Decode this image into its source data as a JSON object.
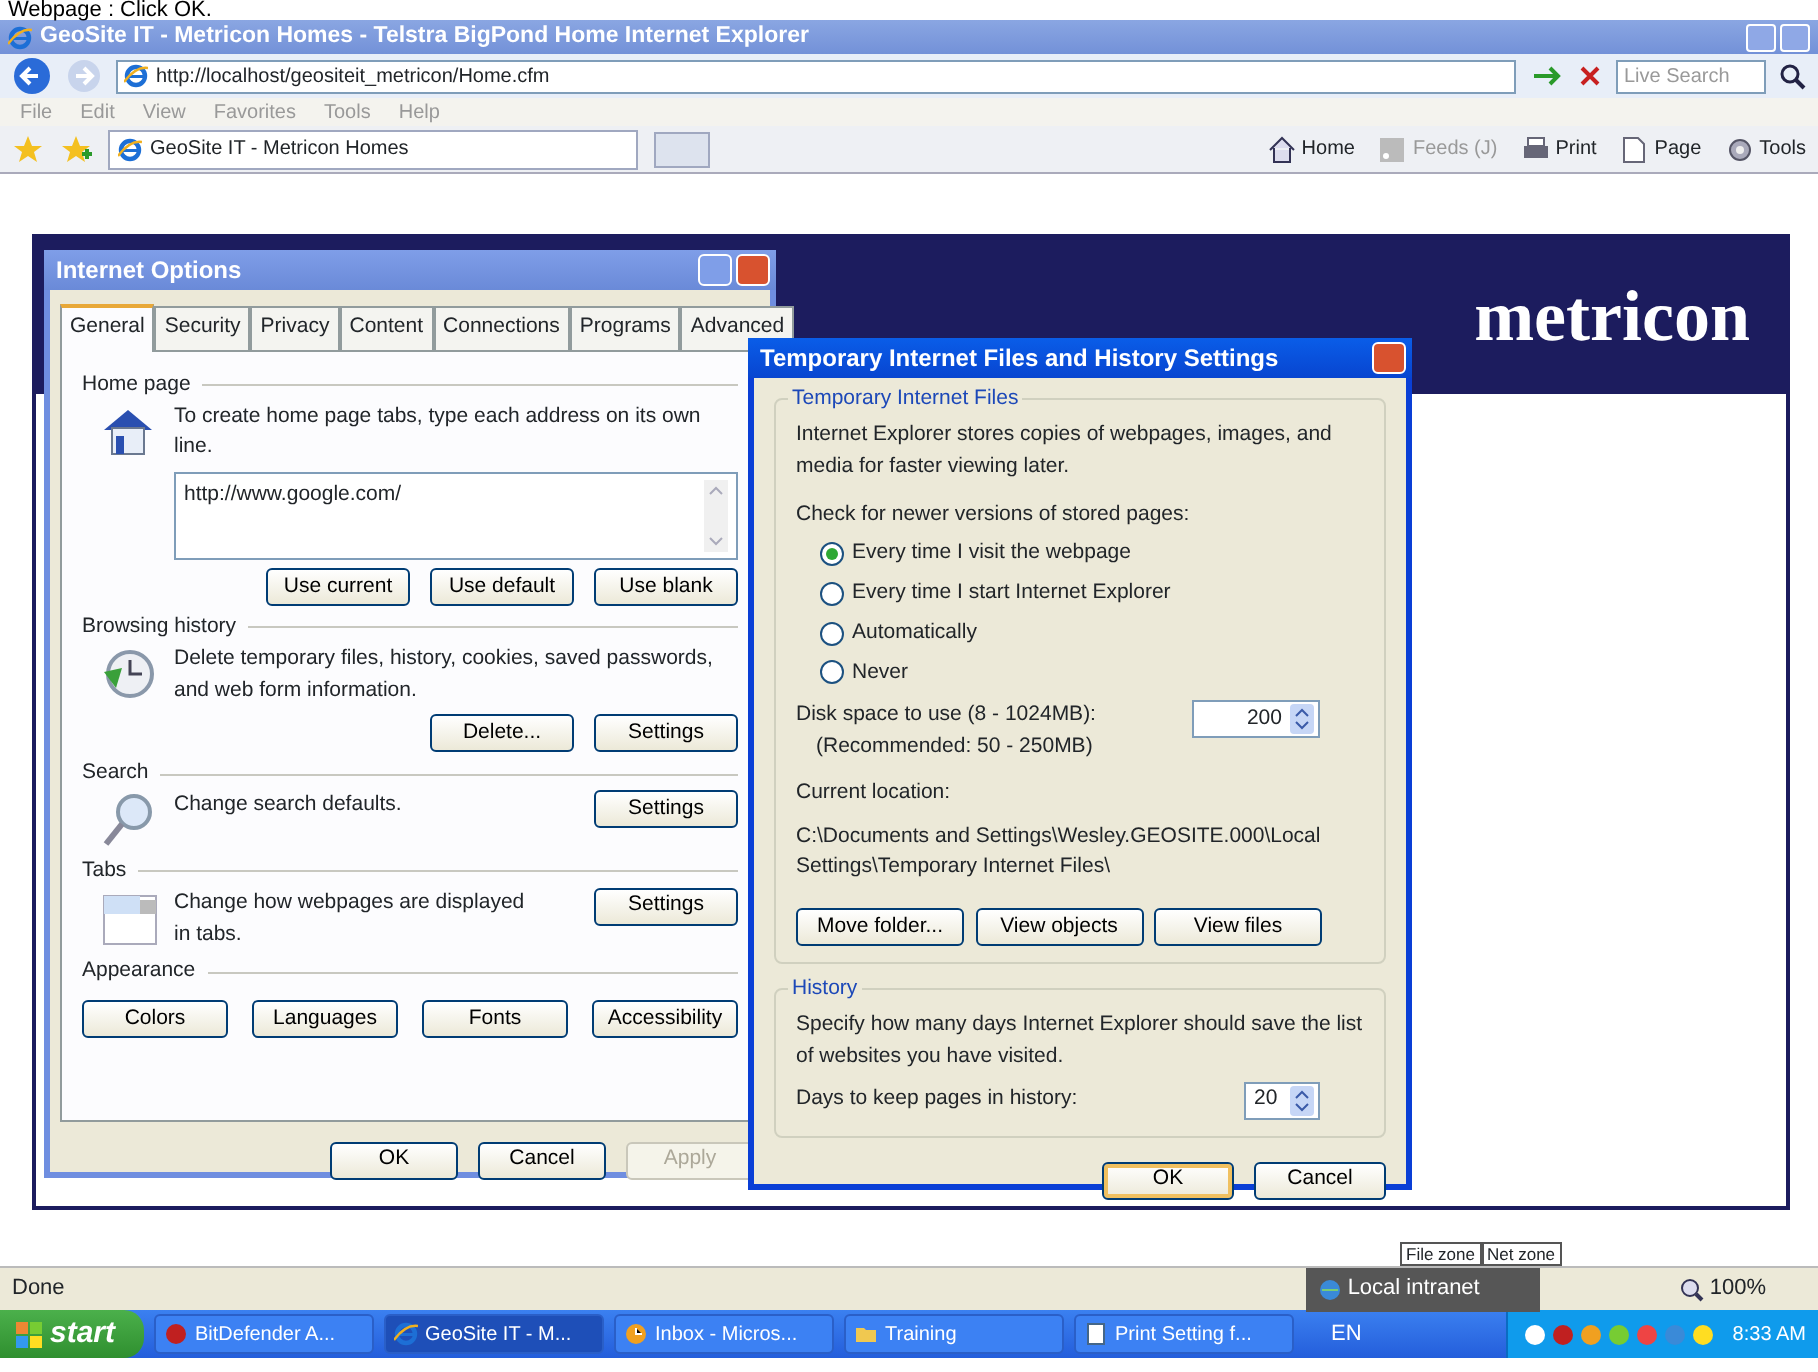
{
  "caption": "Webpage : Click OK.",
  "browser": {
    "title": "GeoSite IT - Metricon Homes - Telstra BigPond Home Internet Explorer",
    "address": "http://localhost/geositeit_metricon/Home.cfm",
    "search_placeholder": "Live Search",
    "menu": [
      "File",
      "Edit",
      "View",
      "Favorites",
      "Tools",
      "Help"
    ],
    "tabs": [
      {
        "label": "GeoSite IT - Metricon Homes",
        "selected": true
      }
    ],
    "toolbar": [
      {
        "label": "Home",
        "kind": "home",
        "disabled": false
      },
      {
        "label": "Feeds (J)",
        "kind": "feeds",
        "disabled": true
      },
      {
        "label": "Print",
        "kind": "print",
        "disabled": false
      },
      {
        "label": "Page",
        "kind": "page",
        "disabled": false
      },
      {
        "label": "Tools",
        "kind": "tools",
        "disabled": false
      }
    ]
  },
  "page": {
    "logo": "metricon"
  },
  "internet_options": {
    "title": "Internet Options",
    "tabs": [
      {
        "label": "General",
        "selected": true
      },
      {
        "label": "Security",
        "selected": false
      },
      {
        "label": "Privacy",
        "selected": false
      },
      {
        "label": "Content",
        "selected": false
      },
      {
        "label": "Connections",
        "selected": false
      },
      {
        "label": "Programs",
        "selected": false
      },
      {
        "label": "Advanced",
        "selected": false
      }
    ],
    "sections": [
      {
        "heading": "Home page",
        "kind": "home",
        "text": "To create home page tabs, type each address on its own line.",
        "value": "http://www.google.com/",
        "buttons": [
          "Use current",
          "Use default",
          "Use blank"
        ]
      },
      {
        "heading": "Browsing history",
        "kind": "history",
        "text": "Delete temporary files, history, cookies, saved passwords, and web form information.",
        "buttons": [
          "Delete...",
          "Settings"
        ]
      },
      {
        "heading": "Search",
        "kind": "search",
        "text": "Change search defaults.",
        "buttons": [
          "Settings"
        ]
      },
      {
        "heading": "Tabs",
        "kind": "tabs",
        "text": "Change how webpages are displayed in tabs.",
        "buttons": [
          "Settings"
        ]
      },
      {
        "heading": "Appearance",
        "kind": "appearance",
        "buttons": [
          "Colors",
          "Languages",
          "Fonts",
          "Accessibility"
        ]
      }
    ],
    "footer": [
      {
        "label": "OK",
        "disabled": false
      },
      {
        "label": "Cancel",
        "disabled": false
      },
      {
        "label": "Apply",
        "disabled": true
      }
    ]
  },
  "temp_dialog": {
    "title": "Temporary Internet Files and History Settings",
    "files_heading": "Temporary Internet Files",
    "files_text": "Internet Explorer stores copies of webpages, images, and media for faster viewing later.",
    "check_label": "Check for newer versions of stored pages:",
    "radios": [
      {
        "label": "Every time I visit the webpage",
        "selected": true
      },
      {
        "label": "Every time I start Internet Explorer",
        "selected": false
      },
      {
        "label": "Automatically",
        "selected": false
      },
      {
        "label": "Never",
        "selected": false
      }
    ],
    "disk_label": "Disk space to use (8 - 1024MB):",
    "disk_note": "(Recommended: 50 - 250MB)",
    "disk_value": "200",
    "location_label": "Current location:",
    "location": "C:\\Documents and Settings\\Wesley.GEOSITE.000\\Local Settings\\Temporary Internet Files\\",
    "buttons": [
      "Move folder...",
      "View objects",
      "View files"
    ],
    "history_heading": "History",
    "history_text": "Specify how many days Internet Explorer should save the list of websites you have visited.",
    "days_label": "Days to keep pages in history:",
    "days_value": "20",
    "footer": [
      {
        "label": "OK",
        "default": true
      },
      {
        "label": "Cancel",
        "default": false
      }
    ]
  },
  "status_bar": {
    "text": "Done",
    "zone_tooltip": [
      "File zone",
      "Net zone"
    ],
    "zone": "Local intranet",
    "zoom": "100%"
  },
  "taskbar": {
    "start": "start",
    "tasks": [
      {
        "label": "BitDefender A...",
        "kind": "shield",
        "selected": false
      },
      {
        "label": "GeoSite IT - M...",
        "kind": "ie",
        "selected": true
      },
      {
        "label": "Inbox - Micros...",
        "kind": "clock",
        "selected": false
      },
      {
        "label": "Training",
        "kind": "folder",
        "selected": false
      },
      {
        "label": "Print Setting f...",
        "kind": "doc",
        "selected": false
      }
    ],
    "language": "EN",
    "clock": "8:33 AM"
  }
}
